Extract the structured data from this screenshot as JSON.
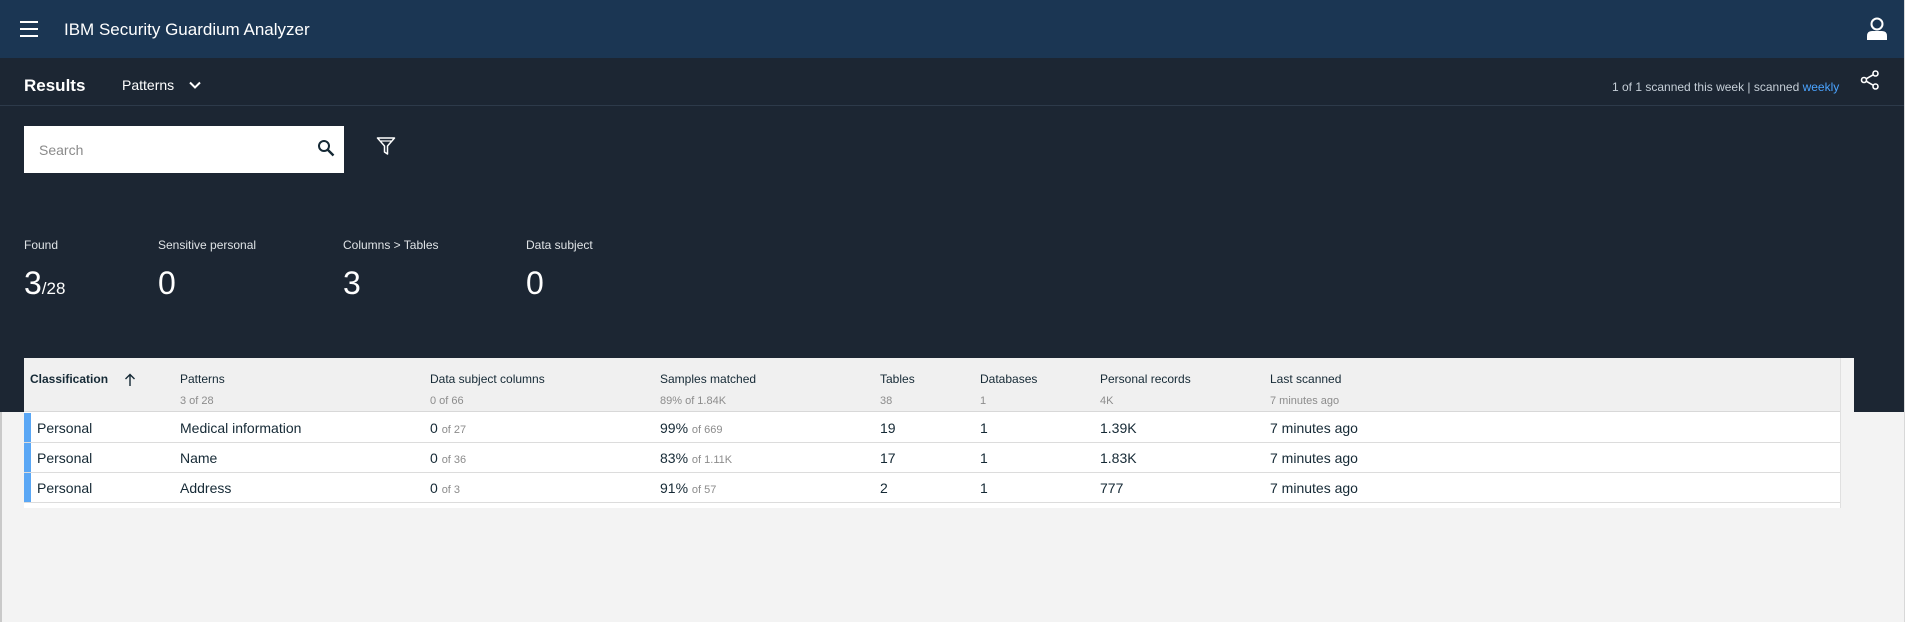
{
  "header": {
    "app_title": "IBM Security Guardium Analyzer",
    "menu_icon": "hamburger-menu-icon",
    "user_icon": "user-icon"
  },
  "results_bar": {
    "title": "Results",
    "view_select": "Patterns",
    "scan_status_prefix": "1 of 1 scanned this week | scanned ",
    "scan_frequency_link": "weekly",
    "share_icon": "share-icon"
  },
  "search": {
    "placeholder": "Search",
    "value": ""
  },
  "stats": [
    {
      "label": "Found",
      "value": "3",
      "suffix": "/28"
    },
    {
      "label": "Sensitive personal",
      "value": "0",
      "suffix": ""
    },
    {
      "label": "Columns > Tables",
      "value": "3",
      "suffix": ""
    },
    {
      "label": "Data subject",
      "value": "0",
      "suffix": ""
    }
  ],
  "table": {
    "columns": [
      {
        "label": "Classification",
        "sub": ""
      },
      {
        "label": "Patterns",
        "sub": "3 of 28"
      },
      {
        "label": "Data subject columns",
        "sub": "0 of 66"
      },
      {
        "label": "Samples matched",
        "sub": "89% of 1.84K"
      },
      {
        "label": "Tables",
        "sub": "38"
      },
      {
        "label": "Databases",
        "sub": "1"
      },
      {
        "label": "Personal records",
        "sub": "4K"
      },
      {
        "label": "Last scanned",
        "sub": "7 minutes ago"
      }
    ],
    "rows": [
      {
        "classification": "Personal",
        "pattern": "Medical information",
        "dsc": "0",
        "dsc_of": "of 27",
        "samples": "99%",
        "samples_of": "of 669",
        "tables": "19",
        "databases": "1",
        "records": "1.39K",
        "last_scanned": "7 minutes ago"
      },
      {
        "classification": "Personal",
        "pattern": "Name",
        "dsc": "0",
        "dsc_of": "of 36",
        "samples": "83%",
        "samples_of": "of 1.11K",
        "tables": "17",
        "databases": "1",
        "records": "1.83K",
        "last_scanned": "7 minutes ago"
      },
      {
        "classification": "Personal",
        "pattern": "Address",
        "dsc": "0",
        "dsc_of": "of 3",
        "samples": "91%",
        "samples_of": "of 57",
        "tables": "2",
        "databases": "1",
        "records": "777",
        "last_scanned": "7 minutes ago"
      }
    ],
    "accent_color": "#5aa7f5"
  },
  "colors": {
    "header_bg": "#1b3653",
    "dark_band_bg": "#1c2633",
    "link": "#4aa3ff"
  }
}
